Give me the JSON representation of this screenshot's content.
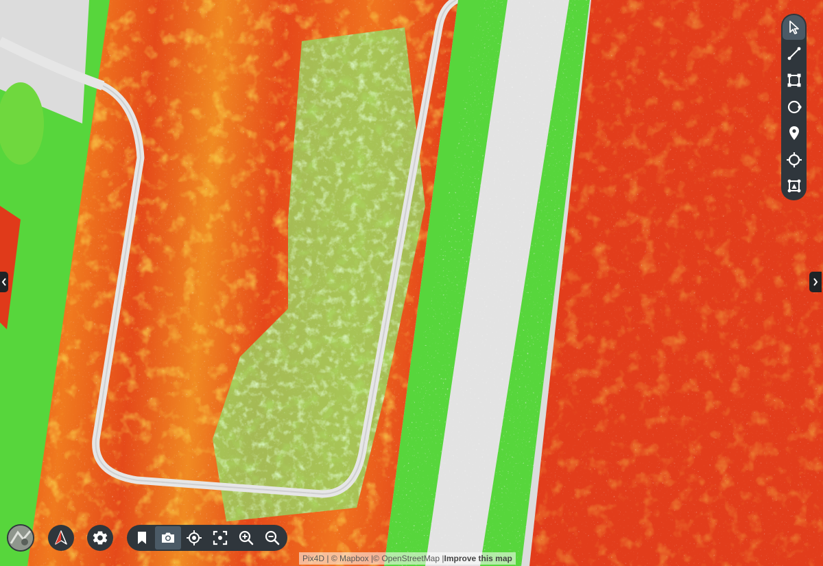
{
  "map": {
    "colors": {
      "background": "#dcdcdc",
      "red": "#e03a1a",
      "orange": "#ef6a1c",
      "yellow": "#f3d21c",
      "green": "#57d63c",
      "light_green": "#a9e98f",
      "road": "#e6e6e6"
    }
  },
  "toolbar_right": {
    "tools": [
      {
        "name": "select-tool",
        "icon": "cursor-arrow-icon",
        "active": true
      },
      {
        "name": "line-tool",
        "icon": "line-measure-icon",
        "active": false
      },
      {
        "name": "polygon-tool",
        "icon": "polygon-area-icon",
        "active": false
      },
      {
        "name": "circle-tool",
        "icon": "circle-area-icon",
        "active": false
      },
      {
        "name": "marker-tool",
        "icon": "map-pin-icon",
        "active": false
      },
      {
        "name": "point-tool",
        "icon": "crosshair-circle-icon",
        "active": false
      },
      {
        "name": "volume-tool",
        "icon": "volume-box-icon",
        "active": false
      }
    ]
  },
  "side_arrows": {
    "left_icon": "chevron-left-icon",
    "right_icon": "chevron-right-icon"
  },
  "bottom_controls": {
    "basemap_icon": "basemap-thumbnail",
    "north_icon": "north-arrow-icon",
    "settings_icon": "gear-icon",
    "bar": [
      {
        "name": "bookmark-button",
        "icon": "bookmark-icon",
        "active": false
      },
      {
        "name": "screenshot-button",
        "icon": "camera-icon",
        "active": true
      },
      {
        "name": "locate-button",
        "icon": "target-icon",
        "active": false
      },
      {
        "name": "fit-view-button",
        "icon": "fullscreen-icon",
        "active": false
      },
      {
        "name": "zoom-in-button",
        "icon": "zoom-in-icon",
        "active": false
      },
      {
        "name": "zoom-out-button",
        "icon": "zoom-out-icon",
        "active": false
      }
    ]
  },
  "attribution": {
    "pix4d": "Pix4D",
    "sep1": " | ",
    "mapbox": "© Mapbox",
    "sep2": " |",
    "osm": "© OpenStreetMap",
    "sep3": " |",
    "improve": "Improve this map"
  }
}
